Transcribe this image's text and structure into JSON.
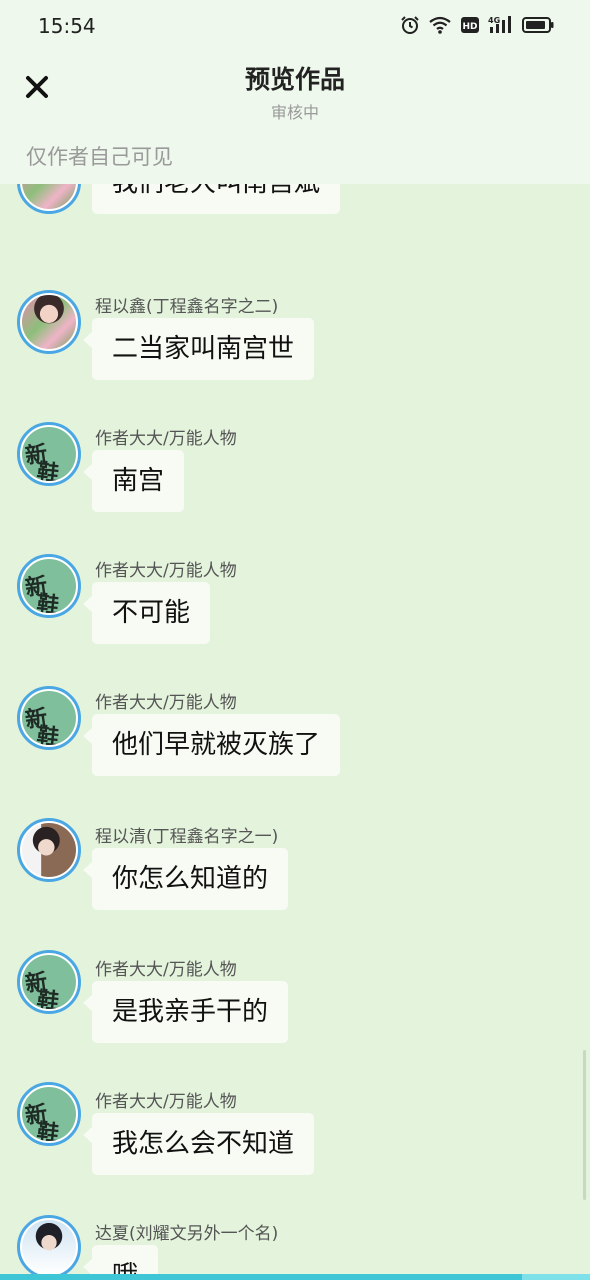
{
  "status_bar": {
    "time": "15:54",
    "icons": [
      "alarm-icon",
      "wifi-icon",
      "hd-icon",
      "signal-4g-icon",
      "battery-icon"
    ],
    "hd_label": "HD",
    "network_label": "4G"
  },
  "header": {
    "close_icon": "close-icon",
    "title": "预览作品",
    "subtitle": "审核中",
    "visibility_note": "仅作者自己可见"
  },
  "messages": [
    {
      "sender": "",
      "avatar": "photo1",
      "text": "我们老大叫南宫斌"
    },
    {
      "sender": "程以鑫(丁程鑫名字之二)",
      "avatar": "photo1",
      "text": "二当家叫南宫世"
    },
    {
      "sender": "作者大大/万能人物",
      "avatar": "green",
      "text": "南宫"
    },
    {
      "sender": "作者大大/万能人物",
      "avatar": "green",
      "text": "不可能"
    },
    {
      "sender": "作者大大/万能人物",
      "avatar": "green",
      "text": "他们早就被灭族了"
    },
    {
      "sender": "程以清(丁程鑫名字之一)",
      "avatar": "photo2",
      "text": "你怎么知道的"
    },
    {
      "sender": "作者大大/万能人物",
      "avatar": "green",
      "text": "是我亲手干的"
    },
    {
      "sender": "作者大大/万能人物",
      "avatar": "green",
      "text": "我怎么会不知道"
    },
    {
      "sender": "达夏(刘耀文另外一个名)",
      "avatar": "photo3",
      "text": "哦"
    }
  ],
  "avatar_glyphs": {
    "top": "新",
    "bottom": "鞋"
  },
  "colors": {
    "accent_border": "#4aa7e4",
    "background": "#e3f3dc",
    "bubble": "#f7fbf3",
    "bottom_strip": "#3fc6d6"
  }
}
